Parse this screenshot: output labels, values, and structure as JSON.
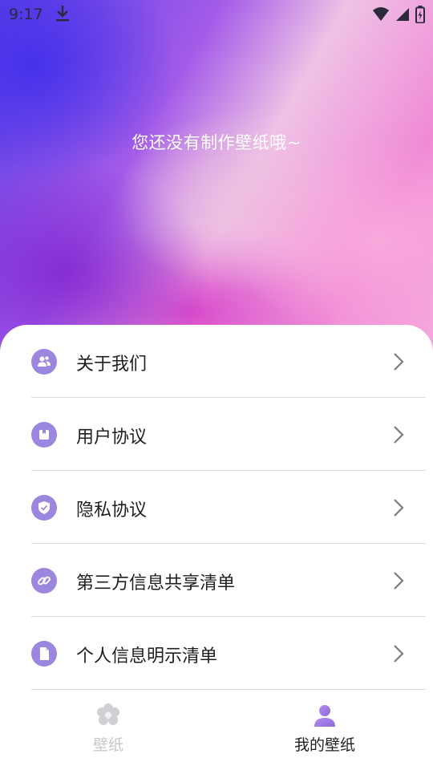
{
  "status_bar": {
    "time": "9:17"
  },
  "hero": {
    "empty_message": "您还没有制作壁纸哦~"
  },
  "menu": {
    "items": [
      {
        "label": "关于我们",
        "icon": "about-us-icon"
      },
      {
        "label": "用户协议",
        "icon": "user-agreement-icon"
      },
      {
        "label": "隐私协议",
        "icon": "privacy-shield-icon"
      },
      {
        "label": "第三方信息共享清单",
        "icon": "link-icon"
      },
      {
        "label": "个人信息明示清单",
        "icon": "document-icon"
      }
    ]
  },
  "tabbar": {
    "tabs": [
      {
        "label": "壁纸",
        "icon": "flower-icon",
        "active": false
      },
      {
        "label": "我的壁纸",
        "icon": "person-icon",
        "active": true
      }
    ]
  },
  "colors": {
    "accent": "#9b86e0",
    "text_primary": "#1f1f1f",
    "tab_inactive": "#c8c8c8"
  }
}
